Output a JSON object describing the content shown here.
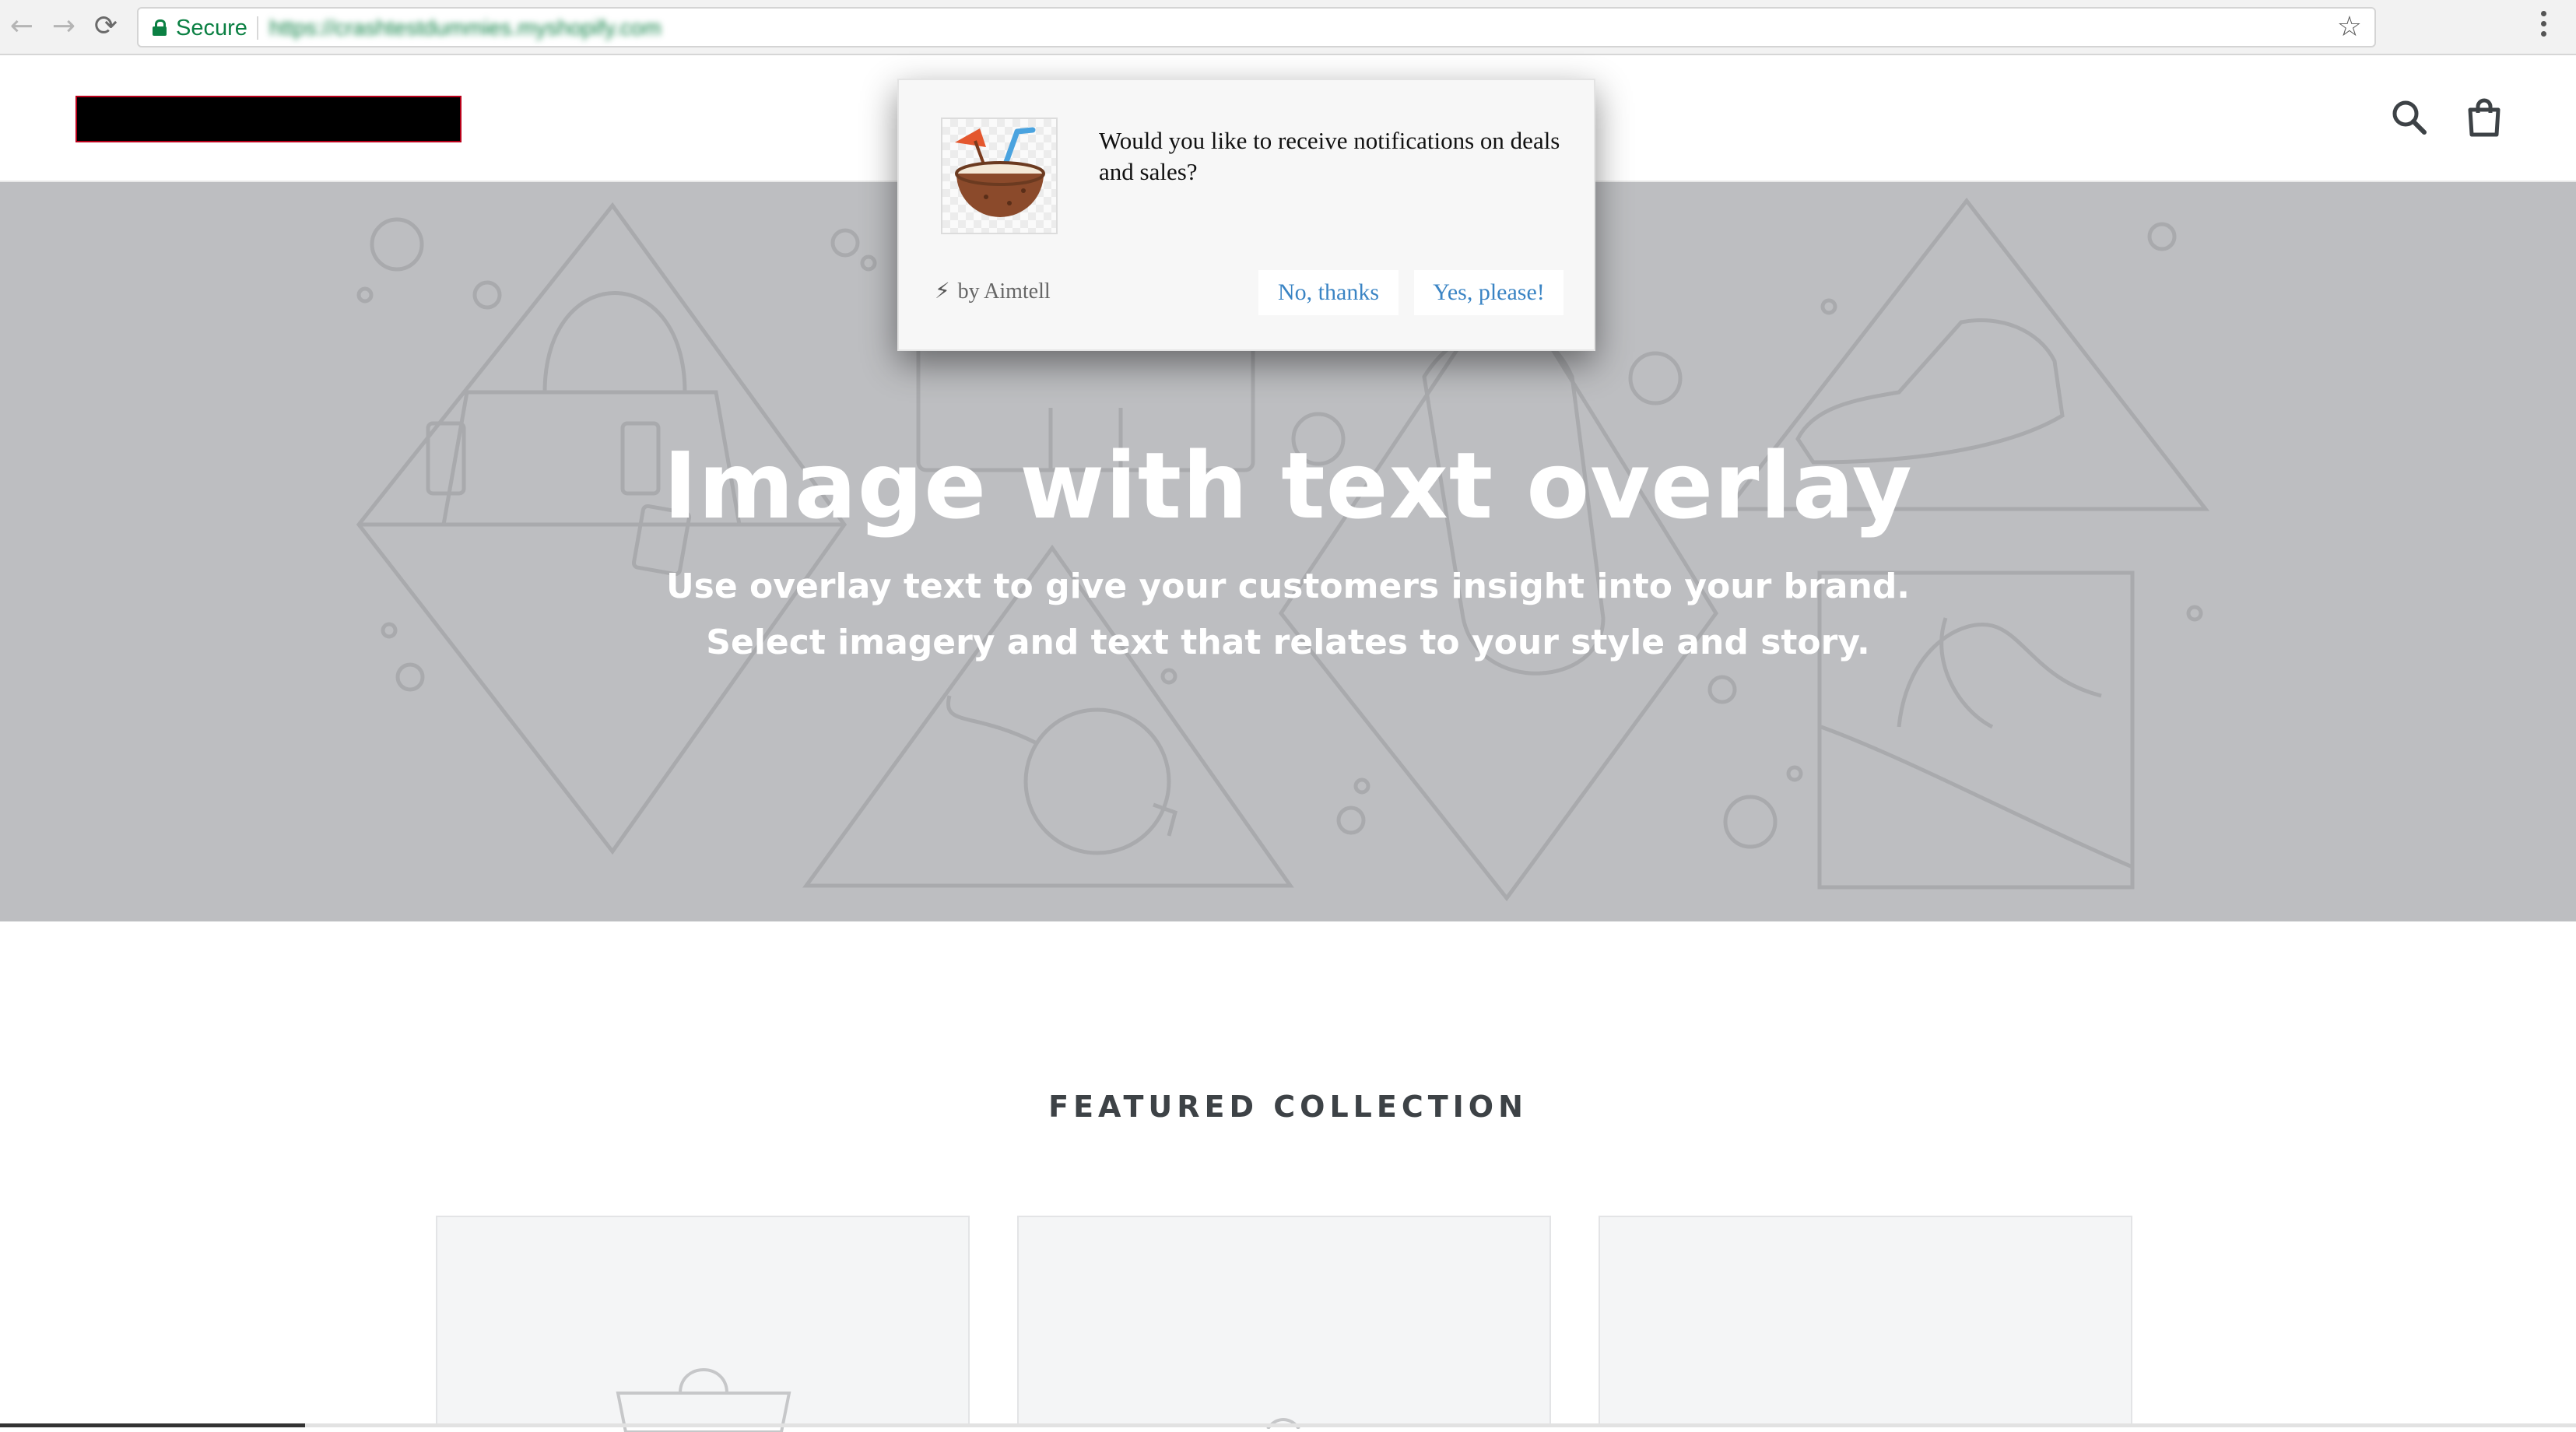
{
  "browser": {
    "secure_label": "Secure",
    "url": "https://crashtestdummies.myshopify.com",
    "back_icon": "back-arrow-icon",
    "forward_icon": "forward-arrow-icon",
    "reload_icon": "reload-icon",
    "bookmark_icon": "star-icon",
    "menu_icon": "kebab-menu-icon"
  },
  "header": {
    "logo": "redacted-logo",
    "search_icon": "search-icon",
    "cart_icon": "shopping-bag-icon"
  },
  "hero": {
    "title": "Image with text overlay",
    "subtitle_line1": "Use overlay text to give your customers insight into your brand.",
    "subtitle_line2": "Select imagery and text that relates to your style and story."
  },
  "featured": {
    "title": "FEATURED COLLECTION"
  },
  "popup": {
    "message": "Would you like to receive notifications on deals and sales?",
    "brand": "by Aimtell",
    "decline_label": "No, thanks",
    "accept_label": "Yes, please!",
    "link_color": "#3a84c4"
  },
  "colors": {
    "hero_bg": "#bdbec1",
    "secure_green": "#0b8043"
  }
}
